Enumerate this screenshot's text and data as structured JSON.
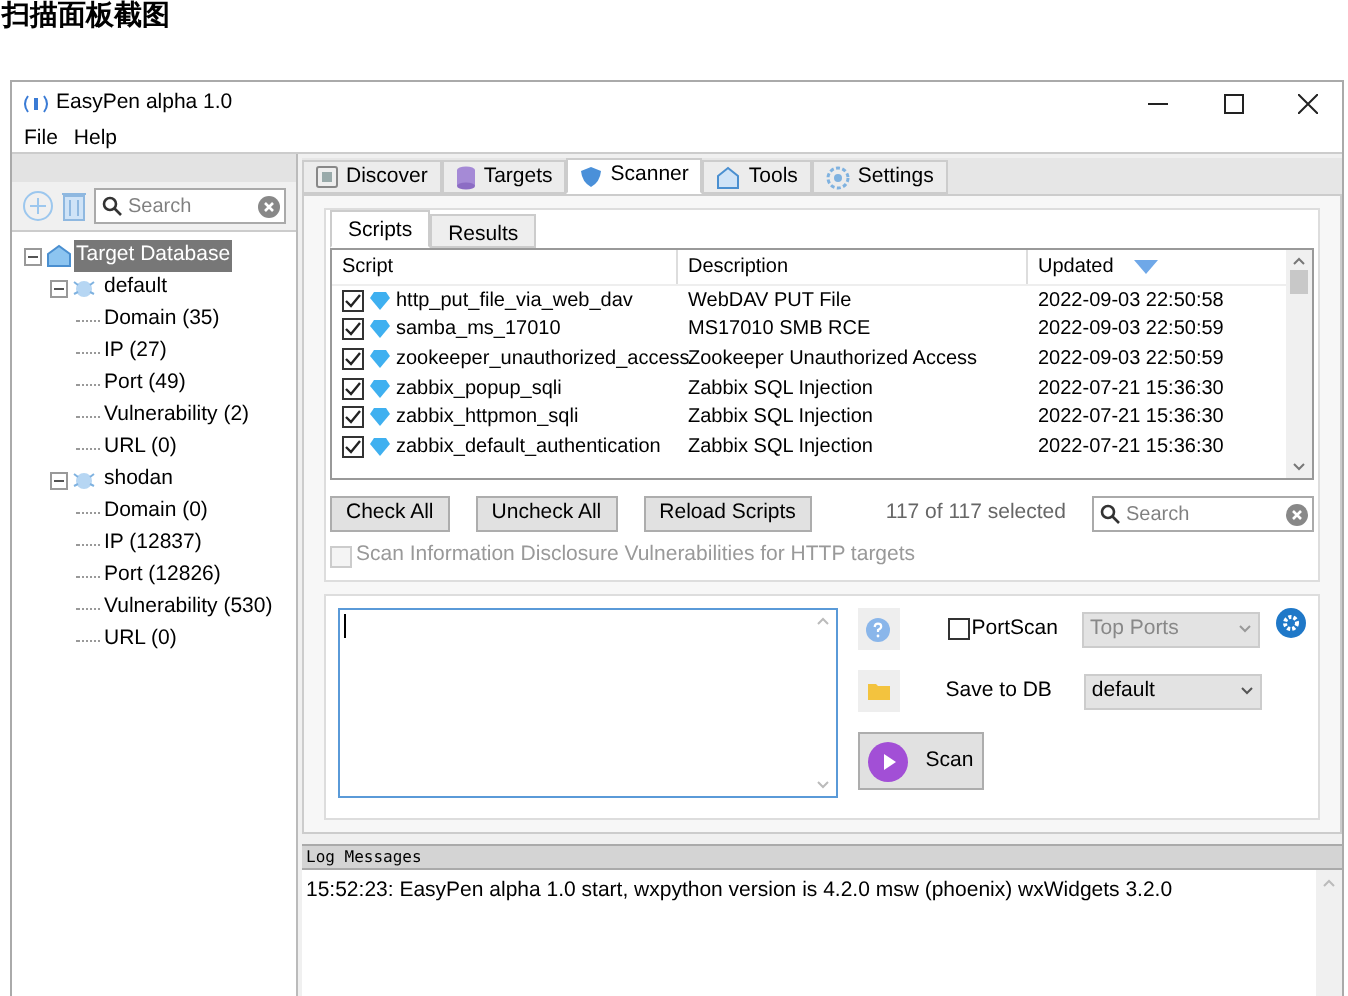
{
  "page_heading": "扫描面板截图",
  "window": {
    "title": "EasyPen alpha 1.0"
  },
  "menu": [
    {
      "label": "File"
    },
    {
      "label": "Help"
    }
  ],
  "sidebar": {
    "search": {
      "placeholder": "Search"
    },
    "tree": [
      {
        "label": "Target Database",
        "selected": true,
        "expanded": true,
        "children": [
          {
            "label": "default",
            "selected": false,
            "expanded": true,
            "children": [
              {
                "label": "Domain (35)"
              },
              {
                "label": "IP (27)"
              },
              {
                "label": "Port (49)"
              },
              {
                "label": "Vulnerability (2)"
              },
              {
                "label": "URL (0)"
              }
            ]
          },
          {
            "label": "shodan",
            "selected": false,
            "expanded": true,
            "children": [
              {
                "label": "Domain (0)"
              },
              {
                "label": "IP (12837)"
              },
              {
                "label": "Port (12826)"
              },
              {
                "label": "Vulnerability (530)"
              },
              {
                "label": "URL (0)"
              }
            ]
          }
        ]
      }
    ]
  },
  "tabs": [
    {
      "label": "Discover",
      "selected": false
    },
    {
      "label": "Targets",
      "selected": false
    },
    {
      "label": "Scanner",
      "selected": true
    },
    {
      "label": "Tools",
      "selected": false
    },
    {
      "label": "Settings",
      "selected": false
    }
  ],
  "subtabs": [
    {
      "label": "Scripts",
      "selected": true
    },
    {
      "label": "Results",
      "selected": false
    }
  ],
  "table": {
    "columns": [
      "Script",
      "Description",
      "Updated"
    ],
    "rows": [
      {
        "checked": true,
        "cells": [
          "http_put_file_via_web_dav",
          "WebDAV PUT File",
          "2022-09-03 22:50:58"
        ]
      },
      {
        "checked": true,
        "cells": [
          "samba_ms_17010",
          "MS17010 SMB RCE",
          "2022-09-03 22:50:59"
        ]
      },
      {
        "checked": true,
        "cells": [
          "zookeeper_unauthorized_access",
          "Zookeeper Unauthorized Access",
          "2022-09-03 22:50:59"
        ]
      },
      {
        "checked": true,
        "cells": [
          "zabbix_popup_sqli",
          "Zabbix SQL Injection",
          "2022-07-21 15:36:30"
        ]
      },
      {
        "checked": true,
        "cells": [
          "zabbix_httpmon_sqli",
          "Zabbix SQL Injection",
          "2022-07-21 15:36:30"
        ]
      },
      {
        "checked": true,
        "cells": [
          "zabbix_default_authentication",
          "Zabbix SQL Injection",
          "2022-07-21 15:36:30"
        ]
      }
    ]
  },
  "buttons": [
    "Check All",
    "Uncheck All",
    "Reload Scripts"
  ],
  "selection_count": "117 of 117 selected",
  "script_search": {
    "placeholder": "Search"
  },
  "info_disclosure": {
    "label": "Scan Information Disclosure Vulnerabilities for HTTP targets",
    "checked": false,
    "disabled": true
  },
  "portscan": {
    "label": "PortScan",
    "checked": false
  },
  "ports_dropdown": {
    "value": "Top Ports",
    "disabled": true
  },
  "save_to_db": {
    "label": "Save to DB",
    "value": "default"
  },
  "scan_button": "Scan",
  "log": {
    "title": "Log Messages",
    "lines": [
      "15:52:23: EasyPen alpha 1.0 start, wxpython version is 4.2.0 msw (phoenix) wxWidgets 3.2.0"
    ]
  }
}
